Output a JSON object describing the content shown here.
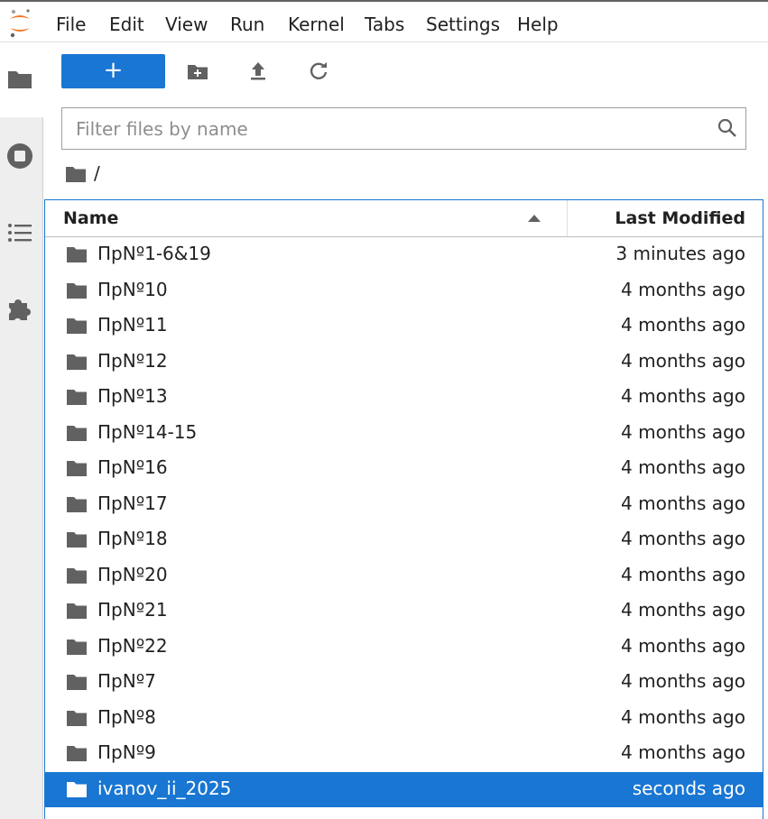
{
  "menu": {
    "items": [
      "File",
      "Edit",
      "View",
      "Run",
      "Kernel",
      "Tabs",
      "Settings",
      "Help"
    ]
  },
  "sidebar": {
    "icons": [
      "folder-icon",
      "running-icon",
      "toc-icon",
      "extension-icon"
    ],
    "active": "folder-icon"
  },
  "toolbar": {
    "new_label": "+",
    "icons": [
      "new-folder-icon",
      "upload-icon",
      "refresh-icon"
    ]
  },
  "filter": {
    "placeholder": "Filter files by name",
    "value": ""
  },
  "breadcrumb": {
    "path": "/"
  },
  "listing": {
    "columns": {
      "name": "Name",
      "modified": "Last Modified"
    },
    "sort": "name-ascending",
    "rows": [
      {
        "name": "ПрNº1-6&19",
        "modified": "3 minutes ago",
        "selected": false
      },
      {
        "name": "ПрNº10",
        "modified": "4 months ago",
        "selected": false
      },
      {
        "name": "ПрNº11",
        "modified": "4 months ago",
        "selected": false
      },
      {
        "name": "ПрNº12",
        "modified": "4 months ago",
        "selected": false
      },
      {
        "name": "ПрNº13",
        "modified": "4 months ago",
        "selected": false
      },
      {
        "name": "ПрNº14-15",
        "modified": "4 months ago",
        "selected": false
      },
      {
        "name": "ПрNº16",
        "modified": "4 months ago",
        "selected": false
      },
      {
        "name": "ПрNº17",
        "modified": "4 months ago",
        "selected": false
      },
      {
        "name": "ПрNº18",
        "modified": "4 months ago",
        "selected": false
      },
      {
        "name": "ПрNº20",
        "modified": "4 months ago",
        "selected": false
      },
      {
        "name": "ПрNº21",
        "modified": "4 months ago",
        "selected": false
      },
      {
        "name": "ПрNº22",
        "modified": "4 months ago",
        "selected": false
      },
      {
        "name": "ПрNº7",
        "modified": "4 months ago",
        "selected": false
      },
      {
        "name": "ПрNº8",
        "modified": "4 months ago",
        "selected": false
      },
      {
        "name": "ПрNº9",
        "modified": "4 months ago",
        "selected": false
      },
      {
        "name": "ivanov_ii_2025",
        "modified": "seconds ago",
        "selected": true
      }
    ]
  },
  "colors": {
    "accent": "#1976d2",
    "logo_orange": "#f37726",
    "icon_gray": "#616161"
  }
}
